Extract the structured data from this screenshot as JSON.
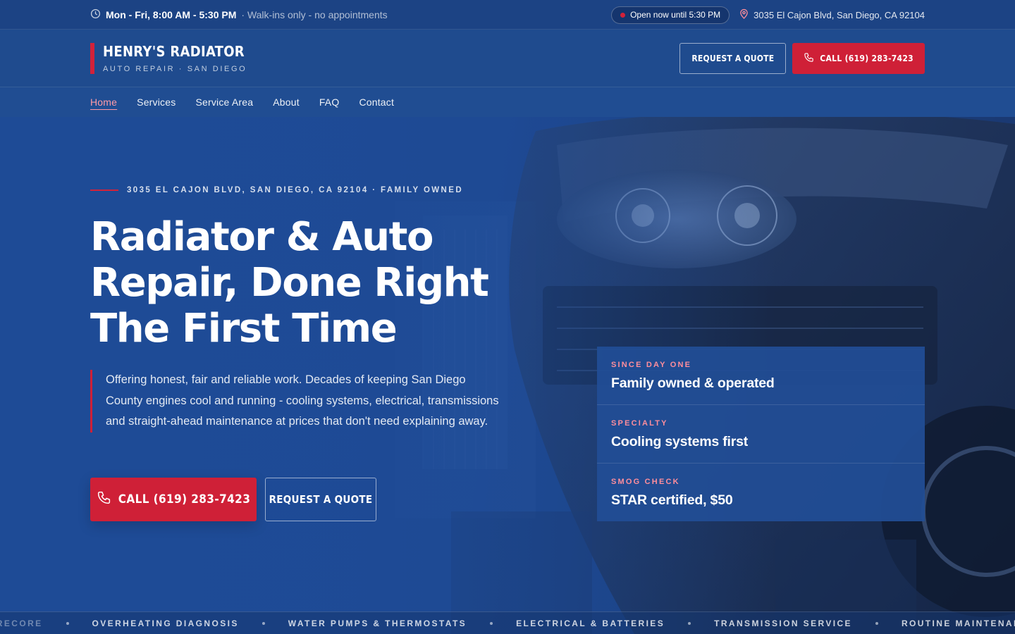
{
  "topbar": {
    "hours": "Mon - Fri, 8:00 AM - 5:30 PM",
    "walkins": "· Walk-ins only - no appointments",
    "open_status": "Open now until 5:30 PM",
    "address": "3035 El Cajon Blvd, San Diego, CA 92104",
    "icons": {
      "hours": "clock-icon",
      "address": "map-pin-icon",
      "status": "status-dot"
    },
    "status_color": "#d2223a"
  },
  "header": {
    "brand_name": "HENRY'S RADIATOR",
    "brand_tagline": "AUTO REPAIR · SAN DIEGO",
    "quote_label": "REQUEST A QUOTE",
    "call_label": "CALL (619) 283-7423"
  },
  "nav": {
    "items": [
      {
        "label": "Home",
        "active": true
      },
      {
        "label": "Services"
      },
      {
        "label": "Service Area"
      },
      {
        "label": "About"
      },
      {
        "label": "FAQ"
      },
      {
        "label": "Contact"
      }
    ]
  },
  "hero": {
    "eyebrow": "3035 EL CAJON BLVD, SAN DIEGO, CA 92104 · FAMILY OWNED",
    "headline": "Radiator & Auto Repair, Done Right The First Time",
    "lede": "Offering honest, fair and reliable work. Decades of keeping San Diego County engines cool and running - cooling systems, electrical, transmissions and straight-ahead maintenance at prices that don't need explaining away.",
    "call_label": "CALL (619) 283-7423",
    "quote_label": "REQUEST A QUOTE",
    "stats": [
      {
        "label": "SINCE DAY ONE",
        "value": "Family owned & operated"
      },
      {
        "label": "SPECIALTY",
        "value": "Cooling systems first"
      },
      {
        "label": "SMOG CHECK",
        "value": "STAR certified, $50"
      }
    ]
  },
  "ticker": {
    "items": [
      "& RECORE",
      "OVERHEATING DIAGNOSIS",
      "WATER PUMPS & THERMOSTATS",
      "ELECTRICAL & BATTERIES",
      "TRANSMISSION SERVICE",
      "ROUTINE MAINTENANCE"
    ]
  },
  "colors": {
    "brand_red": "#cf2037",
    "brand_blue": "#1f4b8e",
    "accent_pink": "#ff8e9c"
  }
}
